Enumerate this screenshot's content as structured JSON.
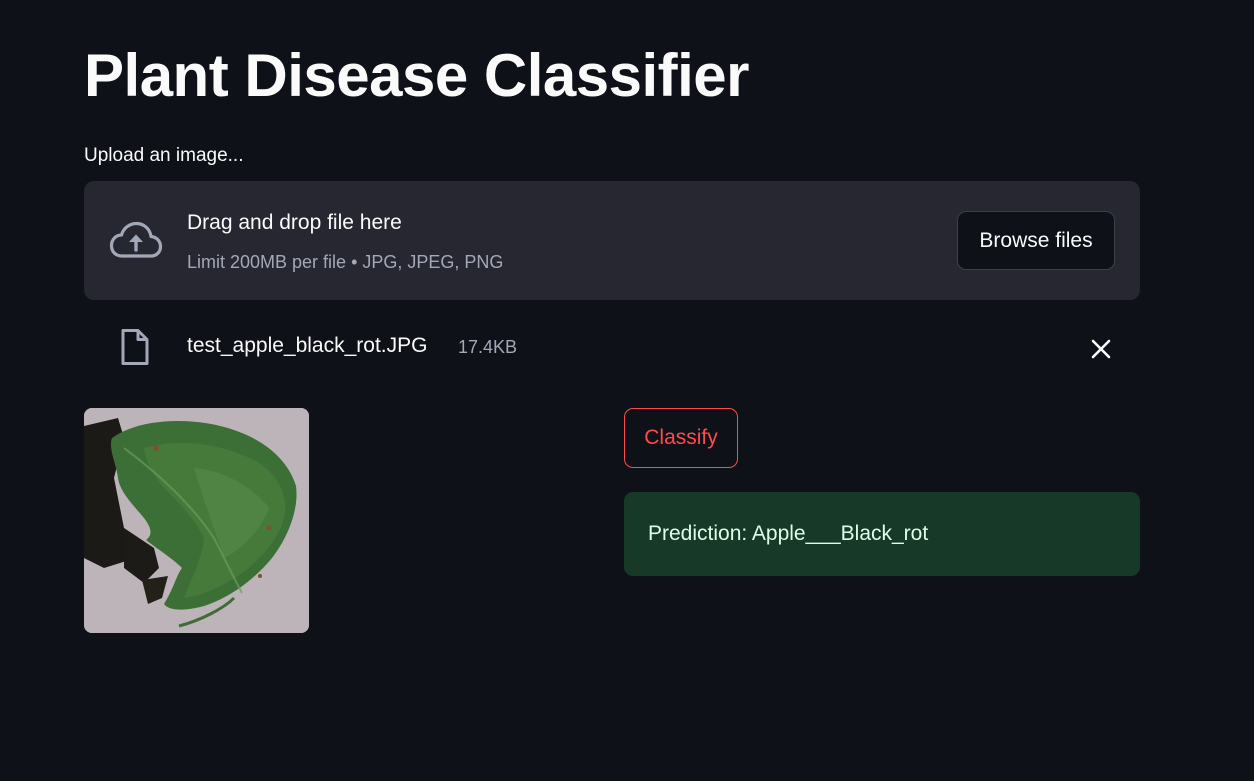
{
  "page": {
    "title": "Plant Disease Classifier"
  },
  "uploader": {
    "label": "Upload an image...",
    "drop_text": "Drag and drop file here",
    "limit_text": "Limit 200MB per file • JPG, JPEG, PNG",
    "browse_label": "Browse files",
    "icon": "cloud-upload-icon"
  },
  "uploaded_file": {
    "name": "test_apple_black_rot.JPG",
    "size": "17.4KB",
    "icon": "file-icon",
    "remove_icon": "close-icon"
  },
  "actions": {
    "classify_label": "Classify"
  },
  "result": {
    "prediction_text": "Prediction: Apple___Black_rot"
  },
  "colors": {
    "background": "#0e1117",
    "dropzone": "#262730",
    "accent_red": "#ff4b4b",
    "success_bg": "#173928",
    "success_text": "#dffde9"
  }
}
